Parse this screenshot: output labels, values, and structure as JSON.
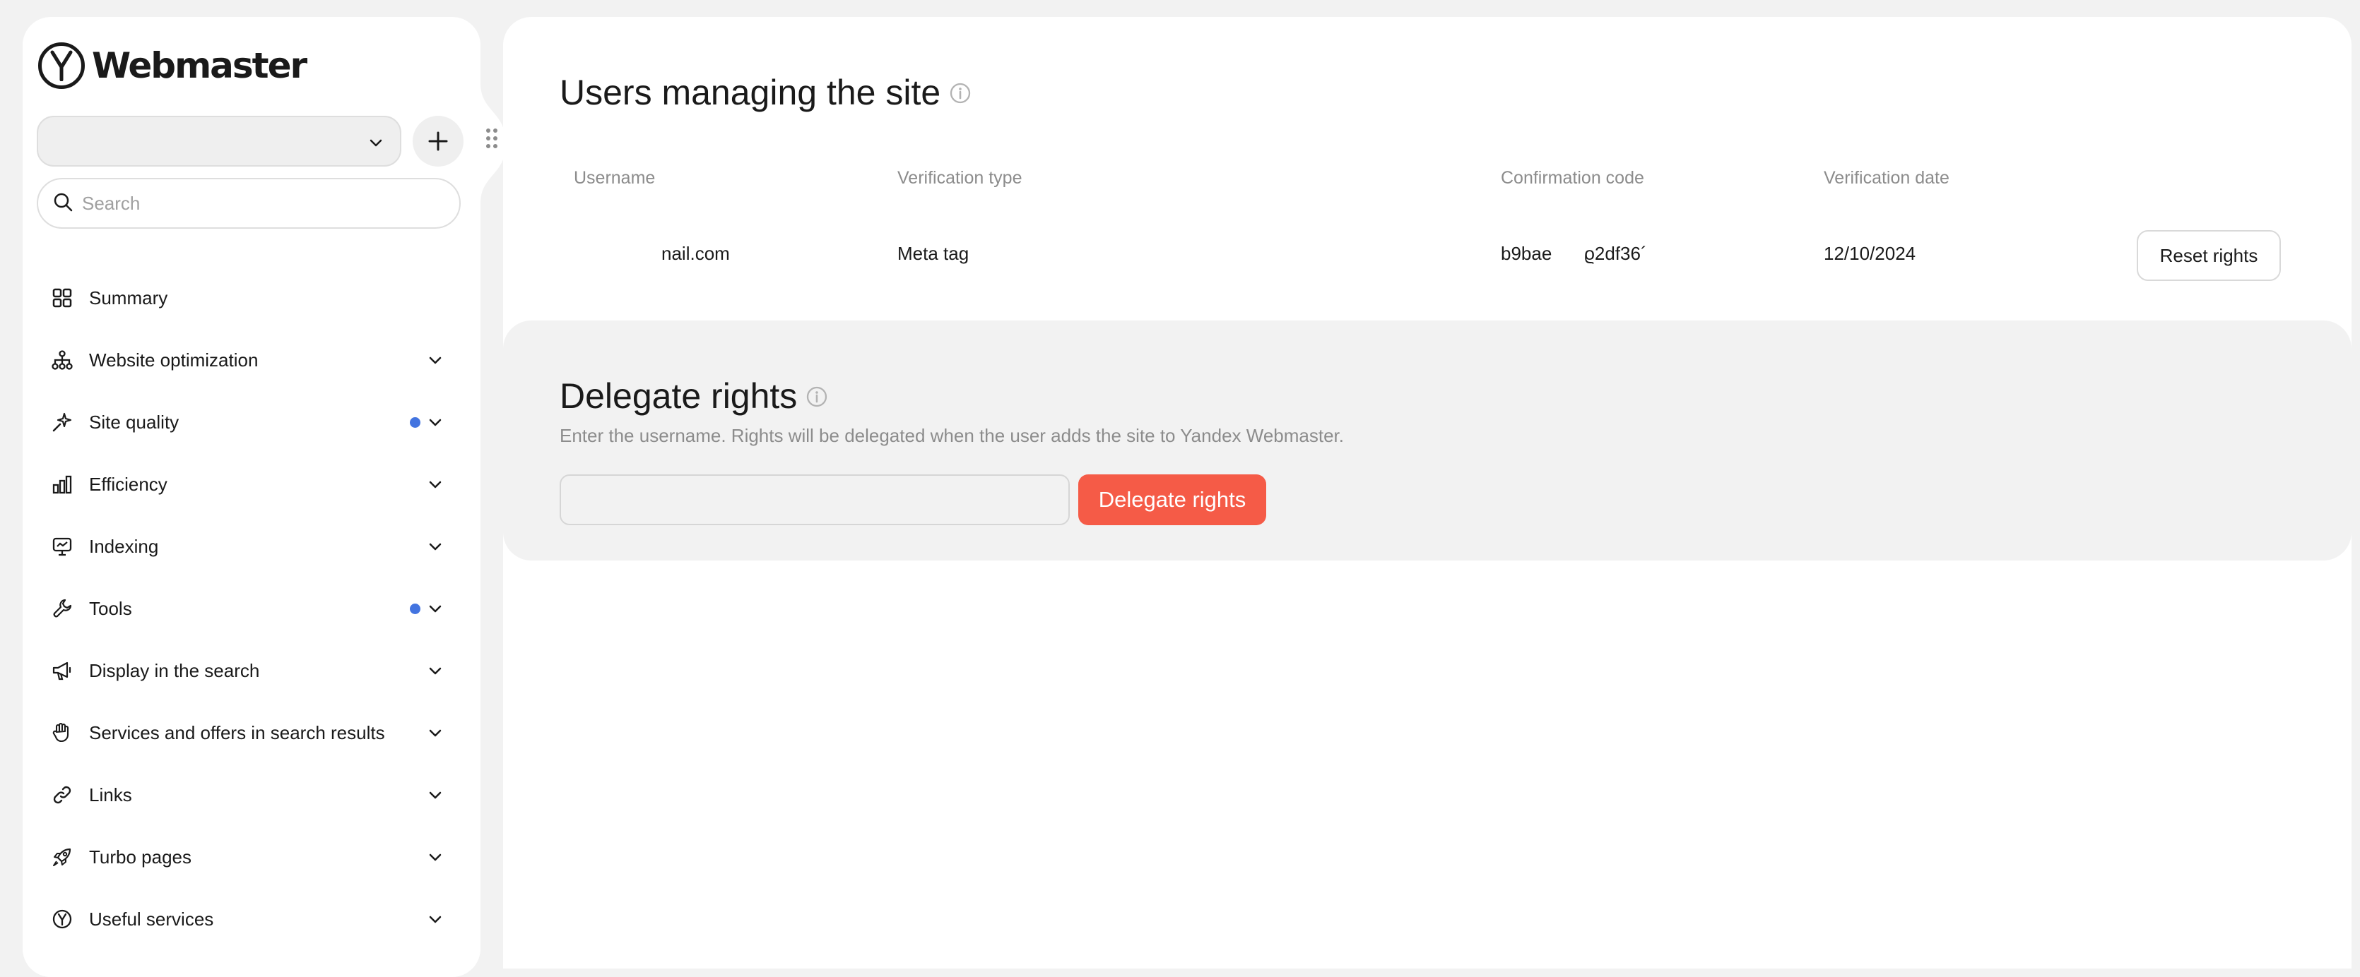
{
  "app": {
    "logo_text": "Webmaster"
  },
  "sidebar": {
    "site_select_value": "",
    "search_placeholder": "Search",
    "items": [
      {
        "label": "Summary",
        "icon": "grid-icon",
        "chevron": false,
        "dot": false
      },
      {
        "label": "Website optimization",
        "icon": "sitemap-icon",
        "chevron": true,
        "dot": false
      },
      {
        "label": "Site quality",
        "icon": "sparkle-icon",
        "chevron": true,
        "dot": true
      },
      {
        "label": "Efficiency",
        "icon": "bar-chart-icon",
        "chevron": true,
        "dot": false
      },
      {
        "label": "Indexing",
        "icon": "monitor-icon",
        "chevron": true,
        "dot": false
      },
      {
        "label": "Tools",
        "icon": "wrench-icon",
        "chevron": true,
        "dot": true
      },
      {
        "label": "Display in the search",
        "icon": "megaphone-icon",
        "chevron": true,
        "dot": false
      },
      {
        "label": "Services and offers in search results",
        "icon": "hand-icon",
        "chevron": true,
        "dot": false
      },
      {
        "label": "Links",
        "icon": "link-icon",
        "chevron": true,
        "dot": false
      },
      {
        "label": "Turbo pages",
        "icon": "rocket-icon",
        "chevron": true,
        "dot": false
      },
      {
        "label": "Useful services",
        "icon": "yandex-icon",
        "chevron": true,
        "dot": false
      }
    ]
  },
  "users_section": {
    "title": "Users managing the site",
    "columns": {
      "username": "Username",
      "verification_type": "Verification type",
      "confirmation_code": "Confirmation code",
      "verification_date": "Verification date"
    },
    "rows": [
      {
        "username": "nail.com",
        "verification_type": "Meta tag",
        "code_start": "b9bae",
        "code_end": "ϱ2df36´",
        "verification_date": "12/10/2024",
        "action": "Reset rights"
      }
    ]
  },
  "delegate_section": {
    "title": "Delegate rights",
    "hint": "Enter the username. Rights will be delegated when the user adds the site to Yandex Webmaster.",
    "input_value": "",
    "button_label": "Delegate rights"
  },
  "colors": {
    "accent": "#f55b47",
    "notification_dot": "#4374e0",
    "page_bg": "#f2f2f2",
    "card_bg": "#ffffff"
  }
}
